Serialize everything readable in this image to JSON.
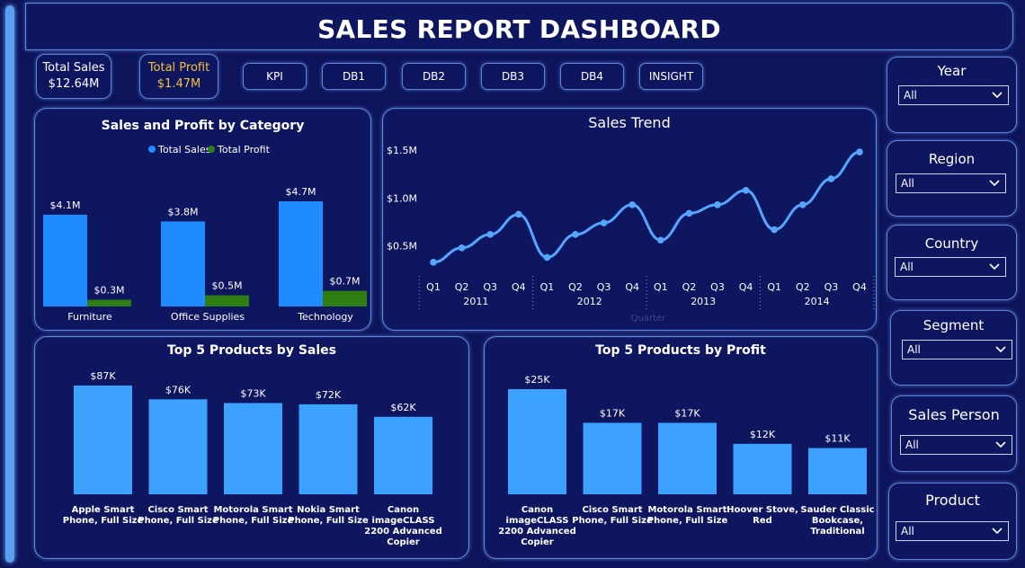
{
  "header": {
    "title": "SALES REPORT DASHBOARD"
  },
  "kpis": {
    "total_sales": {
      "label": "Total Sales",
      "value": "$12.64M"
    },
    "total_profit": {
      "label": "Total Profit",
      "value": "$1.47M"
    }
  },
  "nav": [
    "KPI",
    "DB1",
    "DB2",
    "DB3",
    "DB4",
    "INSIGHT"
  ],
  "filters": [
    {
      "label": "Year",
      "value": "All"
    },
    {
      "label": "Region",
      "value": "All"
    },
    {
      "label": "Country",
      "value": "All"
    },
    {
      "label": "Segment",
      "value": "All"
    },
    {
      "label": "Sales Person",
      "value": "All"
    },
    {
      "label": "Product",
      "value": "All"
    }
  ],
  "colors": {
    "sales": "#1e8bff",
    "profit": "#2e7d12",
    "bar": "#3da2ff",
    "line": "#55a6ff"
  },
  "chart_data": [
    {
      "type": "bar",
      "title": "Sales and Profit by Category",
      "categories": [
        "Furniture",
        "Office Supplies",
        "Technology"
      ],
      "series": [
        {
          "name": "Total Sales",
          "values": [
            4.1,
            3.8,
            4.7
          ],
          "labels": [
            "$4.1M",
            "$3.8M",
            "$4.7M"
          ]
        },
        {
          "name": "Total Profit",
          "values": [
            0.3,
            0.5,
            0.7
          ],
          "labels": [
            "$0.3M",
            "$0.5M",
            "$0.7M"
          ]
        }
      ],
      "ylim": [
        0,
        5
      ]
    },
    {
      "type": "line",
      "title": "Sales Trend",
      "xlabel": "Quarter",
      "quarters": [
        "Q1",
        "Q2",
        "Q3",
        "Q4",
        "Q1",
        "Q2",
        "Q3",
        "Q4",
        "Q1",
        "Q2",
        "Q3",
        "Q4",
        "Q1",
        "Q2",
        "Q3",
        "Q4"
      ],
      "years": [
        "2011",
        "2012",
        "2013",
        "2014"
      ],
      "values": [
        0.33,
        0.48,
        0.62,
        0.83,
        0.38,
        0.62,
        0.74,
        0.93,
        0.56,
        0.84,
        0.93,
        1.08,
        0.67,
        0.93,
        1.2,
        1.48
      ],
      "yticks": [
        "$0.5M",
        "$1.0M",
        "$1.5M"
      ],
      "ytick_values": [
        0.5,
        1.0,
        1.5
      ]
    },
    {
      "type": "bar",
      "title": "Top 5 Products by Sales",
      "categories": [
        [
          "Apple Smart",
          "Phone, Full Size"
        ],
        [
          "Cisco Smart",
          "Phone, Full Size"
        ],
        [
          "Motorola Smart",
          "Phone, Full Size"
        ],
        [
          "Nokia Smart",
          "Phone, Full Size"
        ],
        [
          "Canon",
          "imageCLASS",
          "2200 Advanced",
          "Copier"
        ]
      ],
      "values": [
        87,
        76,
        73,
        72,
        62
      ],
      "labels": [
        "$87K",
        "$76K",
        "$73K",
        "$72K",
        "$62K"
      ]
    },
    {
      "type": "bar",
      "title": "Top 5 Products by Profit",
      "categories": [
        [
          "Canon",
          "imageCLASS",
          "2200 Advanced",
          "Copier"
        ],
        [
          "Cisco Smart",
          "Phone, Full Size"
        ],
        [
          "Motorola Smart",
          "Phone, Full Size"
        ],
        [
          "Hoover Stove,",
          "Red"
        ],
        [
          "Sauder Classic",
          "Bookcase,",
          "Traditional"
        ]
      ],
      "values": [
        25,
        17,
        17,
        12,
        11
      ],
      "labels": [
        "$25K",
        "$17K",
        "$17K",
        "$12K",
        "$11K"
      ]
    }
  ]
}
